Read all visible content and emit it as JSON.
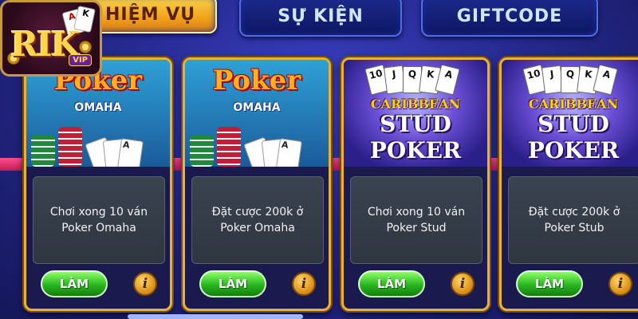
{
  "logo": {
    "word": "RIK",
    "vip": "VIP",
    "card_left": "A",
    "card_right": "K"
  },
  "tabs": [
    {
      "label": "HIỆM VỤ",
      "active": true
    },
    {
      "label": "SỰ KIỆN",
      "active": false
    },
    {
      "label": "GIFTCODE",
      "active": false
    }
  ],
  "cards": [
    {
      "art_type": "omaha",
      "art_title": "Poker",
      "art_sub": "OMAHA",
      "corner": "A",
      "description": "Chơi xong 10 ván Poker Omaha",
      "button": "LÀM",
      "info": "i"
    },
    {
      "art_type": "omaha",
      "art_title": "Poker",
      "art_sub": "OMAHA",
      "corner": "A",
      "description": "Đặt cược 200k ở Poker Omaha",
      "button": "LÀM",
      "info": "i"
    },
    {
      "art_type": "stud",
      "art_title1": "CARIBBEAN",
      "art_title2": "STUD POKER",
      "top_cards": [
        "10",
        "J",
        "Q",
        "K",
        "A"
      ],
      "description": "Chơi xong 10 ván Poker Stud",
      "button": "LÀM",
      "info": "i"
    },
    {
      "art_type": "stud",
      "art_title1": "CARIBBEAN",
      "art_title2": "STUD POKER",
      "top_cards": [
        "10",
        "J",
        "Q",
        "K",
        "A"
      ],
      "description": "Đặt cược 200k ở Poker Stub",
      "button": "LÀM",
      "info": "i"
    }
  ],
  "colors": {
    "background": "#262a8f",
    "active_tab": "#f0a21d",
    "card_border": "#e8b23a",
    "button_green": "#28b61e",
    "rail_pink": "#ff4f8a"
  }
}
